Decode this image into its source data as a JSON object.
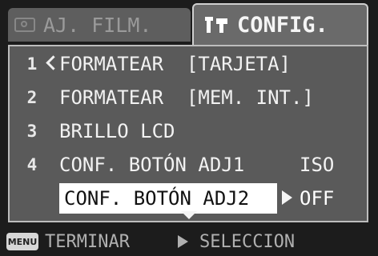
{
  "tabs": [
    {
      "label": "AJ. FILM.",
      "icon": "camera-icon",
      "active": false
    },
    {
      "label": "CONFIG.",
      "icon": "tools-icon",
      "active": true
    }
  ],
  "menu": {
    "items": [
      {
        "num": "1",
        "label": "FORMATEAR  [TARJETA]",
        "value": ""
      },
      {
        "num": "2",
        "label": "FORMATEAR  [MEM. INT.]",
        "value": ""
      },
      {
        "num": "3",
        "label": "BRILLO LCD",
        "value": ""
      },
      {
        "num": "4",
        "label": "CONF. BOTÓN ADJ1",
        "value": "ISO"
      },
      {
        "num": "",
        "label": "CONF. BOTÓN ADJ2",
        "value": "OFF"
      }
    ],
    "selected_index": 4
  },
  "footer": {
    "menu_key": "MENU",
    "exit_label": "TERMINAR",
    "select_label": "SELECCION"
  },
  "colors": {
    "background": "#1c1c1c",
    "panel": "#5a5a5a",
    "highlight": "#ffffff"
  }
}
